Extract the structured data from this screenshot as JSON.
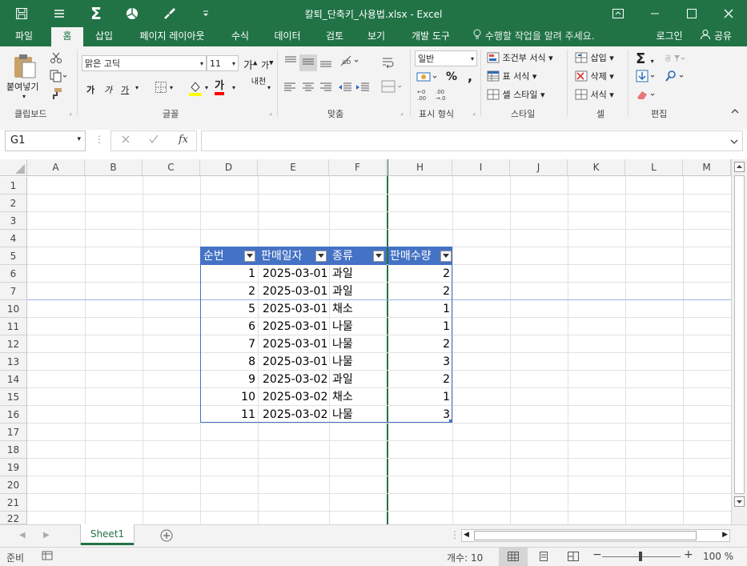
{
  "window": {
    "title": "칼퇴_단축키_사용법.xlsx - Excel",
    "colors": {
      "brand": "#217346",
      "table_header": "#4472c4",
      "table_border": "#4472c4"
    }
  },
  "quick_access": {
    "icons": [
      "save-icon",
      "menu-icon",
      "autosum-icon",
      "chart-icon",
      "brush-icon",
      "customize-icon"
    ]
  },
  "ribbon_tabs": [
    {
      "label": "파일"
    },
    {
      "label": "홈"
    },
    {
      "label": "삽입"
    },
    {
      "label": "페이지 레이아웃"
    },
    {
      "label": "수식"
    },
    {
      "label": "데이터"
    },
    {
      "label": "검토"
    },
    {
      "label": "보기"
    },
    {
      "label": "개발 도구"
    }
  ],
  "tell_me": "수행할 작업을 알려 주세요.",
  "login": "로그인",
  "share": "공유",
  "ribbon": {
    "clipboard": {
      "paste": "붙여넣기",
      "label": "클립보드"
    },
    "font": {
      "name": "맑은 고딕",
      "size": "11",
      "bold": "가",
      "italic": "가",
      "underline": "가",
      "label": "글꼴",
      "font_color_glyph": "가",
      "phonetic_glyph": "내천"
    },
    "alignment": {
      "label": "맞춤"
    },
    "number": {
      "format": "일반",
      "percent": "%",
      "comma": ",",
      "label": "표시 형식"
    },
    "styles": {
      "conditional": "조건부 서식",
      "table": "표 서식",
      "cell": "셀 스타일",
      "label": "스타일"
    },
    "cells": {
      "insert": "삽입",
      "delete": "삭제",
      "format": "서식",
      "label": "셀"
    },
    "editing": {
      "label": "편집"
    }
  },
  "formula_bar": {
    "name_box": "G1",
    "formula": "",
    "fx": "fx"
  },
  "columns": [
    "A",
    "B",
    "C",
    "D",
    "E",
    "F",
    "G",
    "H",
    "I",
    "J",
    "K",
    "L",
    "M"
  ],
  "rows": [
    "1",
    "2",
    "3",
    "4",
    "5",
    "6",
    "7",
    "10",
    "11",
    "12",
    "13",
    "14",
    "15",
    "16",
    "17",
    "18",
    "19",
    "20",
    "21",
    "22"
  ],
  "table": {
    "headers": [
      "순번",
      "판매일자",
      "종류",
      "판매수량"
    ],
    "rows": [
      [
        "1",
        "2025-03-01",
        "과일",
        "2"
      ],
      [
        "2",
        "2025-03-01",
        "과일",
        "2"
      ],
      [
        "5",
        "2025-03-01",
        "채소",
        "1"
      ],
      [
        "6",
        "2025-03-01",
        "나물",
        "1"
      ],
      [
        "7",
        "2025-03-01",
        "나물",
        "2"
      ],
      [
        "8",
        "2025-03-01",
        "나물",
        "3"
      ],
      [
        "9",
        "2025-03-02",
        "과일",
        "2"
      ],
      [
        "10",
        "2025-03-02",
        "채소",
        "1"
      ],
      [
        "11",
        "2025-03-02",
        "나물",
        "3"
      ]
    ]
  },
  "sheets": [
    {
      "label": "Sheet1"
    }
  ],
  "status": {
    "ready": "준비",
    "count": "개수: 10",
    "zoom": "100 %"
  }
}
